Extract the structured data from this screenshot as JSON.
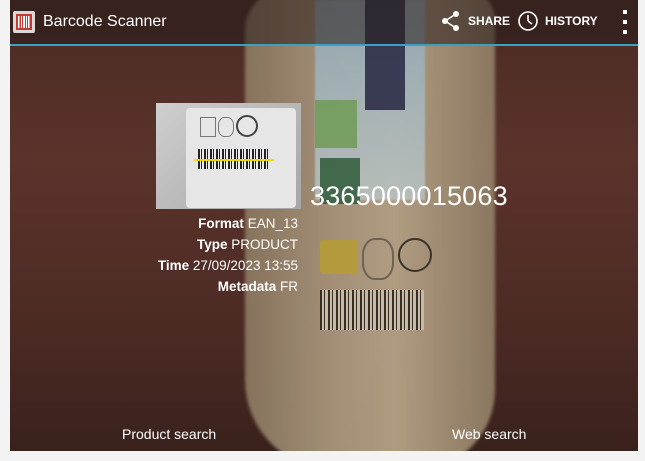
{
  "app": {
    "title": "Barcode Scanner"
  },
  "actions": {
    "share_label": "SHARE",
    "history_label": "HISTORY"
  },
  "result": {
    "code": "3365000015063",
    "format_key": "Format",
    "format_value": "EAN_13",
    "type_key": "Type",
    "type_value": "PRODUCT",
    "time_key": "Time",
    "time_value": "27/09/2023 13:55",
    "metadata_key": "Metadata",
    "metadata_value": "FR"
  },
  "buttons": {
    "product_search": "Product search",
    "web_search": "Web search"
  },
  "colors": {
    "accent_line": "#3aa0c8",
    "text": "#ffffff"
  },
  "icons": [
    "barcode-app-icon",
    "share-icon",
    "history-icon",
    "overflow-menu-icon"
  ]
}
